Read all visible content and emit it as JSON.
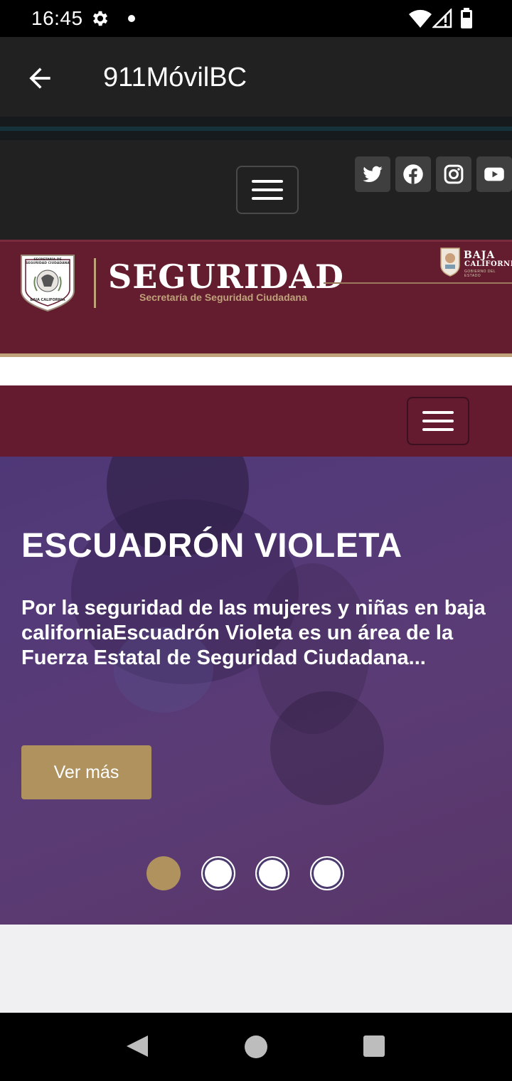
{
  "status_bar": {
    "time": "16:45",
    "icons": [
      "gear-icon",
      "dot-icon",
      "wifi-icon",
      "signal-icon",
      "battery-icon"
    ]
  },
  "app_bar": {
    "title": "911MóvilBC",
    "back_icon": "arrow-back-icon"
  },
  "site_nav": {
    "menu_icon": "hamburger-menu-icon",
    "social": [
      {
        "name": "twitter-icon"
      },
      {
        "name": "facebook-icon"
      },
      {
        "name": "instagram-icon"
      },
      {
        "name": "youtube-icon"
      }
    ]
  },
  "header": {
    "crest_text": [
      "SECRETARÍA DE",
      "SEGURIDAD CIUDADANA",
      "BAJA CALIFORNIA"
    ],
    "title": "SEGURIDAD",
    "subtitle": "Secretaría de Seguridad Ciudadana",
    "bc_title": "BAJA",
    "bc_sub": "CALIFORNIA",
    "bc_tiny": "GOBIERNO DEL ESTADO"
  },
  "hero": {
    "title": "ESCUADRÓN VIOLETA",
    "description": "Por la seguridad de las mujeres y niñas en baja californiaEscuadrón Violeta es un área de la Fuerza Estatal de Seguridad Ciudadana...",
    "button_label": "Ver más",
    "slides": 4,
    "active_slide": 1
  },
  "colors": {
    "maroon": "#641d2f",
    "gold": "#b0925f",
    "violet": "#553a78",
    "dark": "#212121"
  }
}
